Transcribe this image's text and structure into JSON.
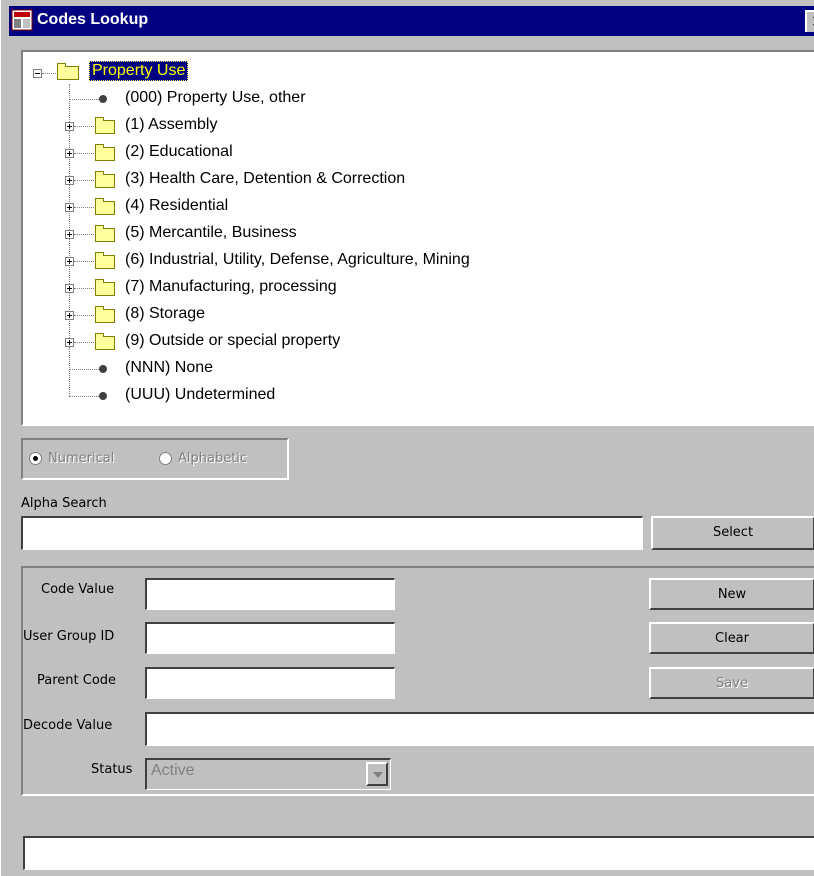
{
  "window": {
    "title": "Codes Lookup",
    "close": "✕"
  },
  "tree": {
    "root": "Property Use",
    "items": [
      {
        "label": "(000) Property Use, other",
        "type": "leaf"
      },
      {
        "label": "(1) Assembly",
        "type": "folder"
      },
      {
        "label": "(2) Educational",
        "type": "folder"
      },
      {
        "label": "(3) Health Care, Detention & Correction",
        "type": "folder"
      },
      {
        "label": "(4) Residential",
        "type": "folder"
      },
      {
        "label": "(5) Mercantile, Business",
        "type": "folder"
      },
      {
        "label": "(6) Industrial, Utility, Defense, Agriculture, Mining",
        "type": "folder"
      },
      {
        "label": "(7) Manufacturing, processing",
        "type": "folder"
      },
      {
        "label": "(8) Storage",
        "type": "folder"
      },
      {
        "label": "(9) Outside or special property",
        "type": "folder"
      },
      {
        "label": "(NNN) None",
        "type": "leaf"
      },
      {
        "label": "(UUU) Undetermined",
        "type": "leaf"
      }
    ]
  },
  "sort": {
    "numerical": "Numerical",
    "alphabetic": "Alphabetic",
    "selected": "numerical"
  },
  "search": {
    "label": "Alpha Search",
    "value": "",
    "select": "Select"
  },
  "form": {
    "code_value": {
      "label": "Code Value",
      "value": ""
    },
    "user_group": {
      "label": "User Group ID",
      "value": ""
    },
    "parent_code": {
      "label": "Parent Code",
      "value": ""
    },
    "decode_value": {
      "label": "Decode Value",
      "value": ""
    },
    "status": {
      "label": "Status",
      "value": "Active"
    }
  },
  "buttons": {
    "new": "New",
    "clear": "Clear",
    "save": "Save"
  },
  "status_bar": {
    "value": ""
  },
  "colors": {
    "titlebar": "#000080",
    "face": "#c0c0c0",
    "selection": "#000080",
    "folder": "#ffff9c"
  }
}
